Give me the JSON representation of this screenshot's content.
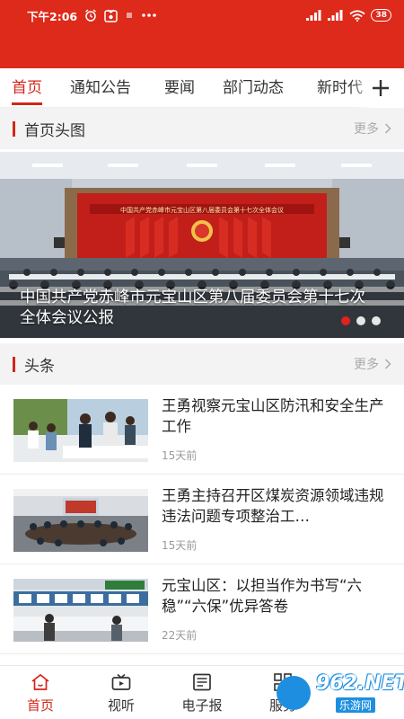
{
  "status_bar": {
    "time": "下午2:06",
    "battery": "38",
    "icons": [
      "alarm-icon",
      "app-icon",
      "dot-icon",
      "more-dots-icon",
      "signal-icon",
      "signal-icon",
      "wifi-icon",
      "battery-icon"
    ]
  },
  "theme": {
    "brand_red": "#dd2a1b",
    "accent_red": "#d2261a"
  },
  "tabs": [
    {
      "label": "首页",
      "active": true
    },
    {
      "label": "通知公告"
    },
    {
      "label": "要闻"
    },
    {
      "label": "部门动态"
    },
    {
      "label": "新时代"
    }
  ],
  "sections": {
    "headline_images": {
      "title": "首页头图",
      "more": "更多"
    },
    "top_news": {
      "title": "头条",
      "more": "更多"
    }
  },
  "banner": {
    "stage_banner_text": "中国共产党赤峰市元宝山区第八届委员会第十七次全体会议",
    "caption": "中国共产党赤峰市元宝山区第八届委员会第十七次全体会议公报",
    "slide_count": 3,
    "active_slide": 1
  },
  "news": [
    {
      "title": "王勇视察元宝山区防汛和安全生产工作",
      "age": "15天前"
    },
    {
      "title": "王勇主持召开区煤炭资源领域违规违法问题专项整治工…",
      "age": "15天前"
    },
    {
      "title": "元宝山区：以担当作为书写“六稳”“六保”优异答卷",
      "age": "22天前"
    }
  ],
  "bottom_nav": [
    {
      "label": "首页",
      "icon": "home-icon",
      "active": true
    },
    {
      "label": "视听",
      "icon": "tv-icon"
    },
    {
      "label": "电子报",
      "icon": "newspaper-icon"
    },
    {
      "label": "服务",
      "icon": "grid-icon"
    }
  ],
  "watermark": {
    "text": "962.NET",
    "sub": "乐游网"
  }
}
